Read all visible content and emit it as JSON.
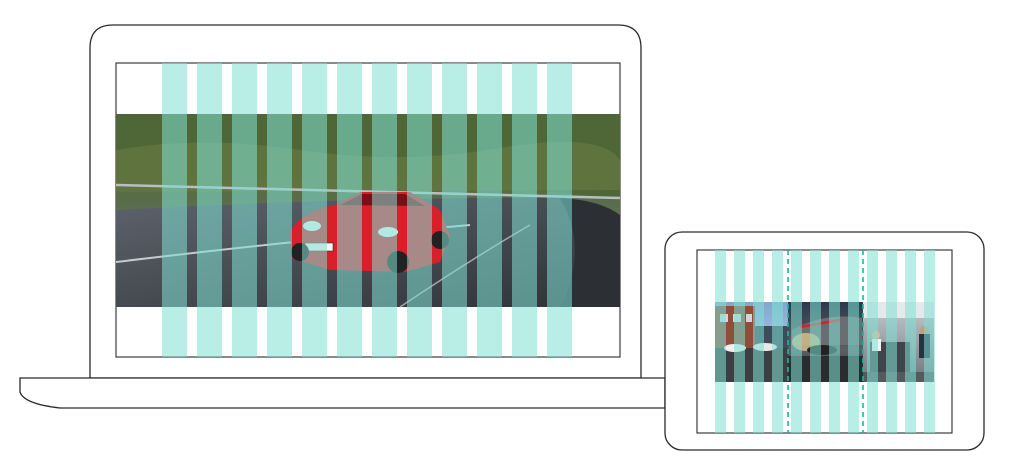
{
  "colors": {
    "grid_column": "#7fe0d3",
    "grid_guide": "#15b8a7",
    "device_outline": "#2a2a2a",
    "device_fill": "#ffffff",
    "car": "#d81f2a",
    "mountain": "#556a3c",
    "road": "#4c5157",
    "sky": "#a9c4dc",
    "building": "#8e4f3a",
    "showroom": "#3a3f46"
  },
  "laptop": {
    "grid_columns": 12,
    "hero_image": "red-roadster-on-mountain-road"
  },
  "tablet": {
    "grid_columns": 12,
    "guide_lines": 2,
    "image_panels": [
      "dealership-exterior",
      "porsche-showroom-night",
      "reception-desk-interior"
    ]
  }
}
